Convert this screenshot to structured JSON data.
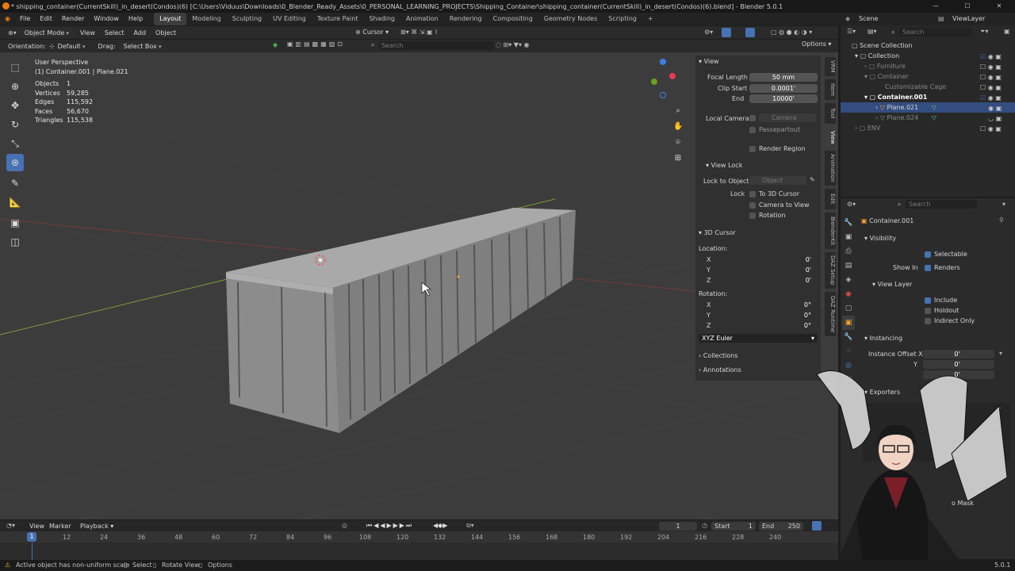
{
  "title_bar": {
    "title": "* shipping_container(CurrentSkill)_in_desert(Condos)(6) [C:\\Users\\Viduus\\Downloads\\0_Blender_Ready_Assets\\0_PERSONAL_LEARNING_PROJECTS\\Shipping_Container\\shipping_container(CurrentSkill)_in_desert(Condos)(6).blend] - Blender 5.0.1",
    "minimize": "—",
    "maximize": "☐",
    "close": "✕"
  },
  "menu": {
    "file": "File",
    "edit": "Edit",
    "render": "Render",
    "window": "Window",
    "help": "Help"
  },
  "workspaces": [
    "Layout",
    "Modeling",
    "Sculpting",
    "UV Editing",
    "Texture Paint",
    "Shading",
    "Animation",
    "Rendering",
    "Compositing",
    "Geometry Nodes",
    "Scripting"
  ],
  "workspace_add": "+",
  "scene": {
    "scene_label": "Scene",
    "viewlayer_label": "ViewLayer"
  },
  "viewport_header": {
    "mode": "Object Mode",
    "view": "View",
    "select": "Select",
    "add": "Add",
    "object": "Object",
    "transform_pivot": "Cursor",
    "search_placeholder": "Search",
    "options": "Options"
  },
  "tool_settings": {
    "orientation_label": "Orientation:",
    "orientation_value": "Default",
    "drag_label": "Drag:",
    "drag_value": "Select Box"
  },
  "viewport_info": {
    "perspective": "User Perspective",
    "object_line": "(1) Container.001 | Plane.021"
  },
  "stats": [
    {
      "k": "Objects",
      "v": "1"
    },
    {
      "k": "Vertices",
      "v": "59,285"
    },
    {
      "k": "Edges",
      "v": "115,592"
    },
    {
      "k": "Faces",
      "v": "56,670"
    },
    {
      "k": "Triangles",
      "v": "115,538"
    }
  ],
  "npanel": {
    "view_header": "View",
    "focal_length_label": "Focal Length",
    "focal_length": "50 mm",
    "clip_start_label": "Clip Start",
    "clip_start": "0.0001'",
    "end_label": "End",
    "clip_end": "10000'",
    "local_camera_label": "Local Camera",
    "camera_placeholder": "Camera",
    "passepartout": "Passepartout",
    "render_region": "Render Region",
    "view_lock_header": "View Lock",
    "lock_to_object_label": "Lock to Object",
    "object_placeholder": "Object",
    "lock_label": "Lock",
    "to_3d_cursor": "To 3D Cursor",
    "camera_to_view": "Camera to View",
    "rotation_chk": "Rotation",
    "cursor_header": "3D Cursor",
    "location_label": "Location:",
    "loc": [
      {
        "axis": "X",
        "v": "0'"
      },
      {
        "axis": "Y",
        "v": "0'"
      },
      {
        "axis": "Z",
        "v": "0'"
      }
    ],
    "rotation_label": "Rotation:",
    "rot": [
      {
        "axis": "X",
        "v": "0°"
      },
      {
        "axis": "Y",
        "v": "0°"
      },
      {
        "axis": "Z",
        "v": "0°"
      }
    ],
    "rotation_mode": "XYZ Euler",
    "collections": "Collections",
    "annotations": "Annotations"
  },
  "side_tabs": [
    "VRM",
    "Item",
    "Tool",
    "View",
    "Animation",
    "Edit",
    "BlenderKit",
    "DAZ Setup",
    "DAZ Runtime"
  ],
  "outliner": {
    "search_placeholder": "Search",
    "items": [
      {
        "label": "Scene Collection"
      },
      {
        "label": "Collection"
      },
      {
        "label": "Furniture"
      },
      {
        "label": "Container"
      },
      {
        "label": "Customizable Cage"
      },
      {
        "label": "Container.001"
      },
      {
        "label": "Plane.021"
      },
      {
        "label": "Plane.024"
      },
      {
        "label": "ENV"
      }
    ]
  },
  "properties": {
    "search_placeholder": "Search",
    "object_name": "Container.001",
    "visibility_header": "Visibility",
    "selectable": "Selectable",
    "show_in_label": "Show In",
    "renders": "Renders",
    "view_layer_header": "View Layer",
    "include": "Include",
    "holdout": "Holdout",
    "indirect_only": "Indirect Only",
    "instancing_header": "Instancing",
    "instance_offset_label": "Instance Offset X",
    "y_label": "Y",
    "offset": [
      "0'",
      "0'",
      "0'"
    ],
    "exporters_header": "Exporters",
    "mask_label": "o Mask"
  },
  "timeline": {
    "view": "View",
    "marker": "Marker",
    "playback": "Playback",
    "current_frame": "1",
    "start_label": "Start",
    "start": "1",
    "end_label": "End",
    "end": "250",
    "ticks": [
      "12",
      "24",
      "36",
      "48",
      "60",
      "72",
      "84",
      "96",
      "108",
      "120",
      "132",
      "144",
      "156",
      "168",
      "180",
      "192",
      "204",
      "216",
      "228",
      "240"
    ],
    "playhead": "1"
  },
  "statusbar": {
    "warning": "Active object has non-uniform scale",
    "select": "Select",
    "rotate_view": "Rotate View",
    "options": "Options",
    "version": "5.0.1"
  }
}
